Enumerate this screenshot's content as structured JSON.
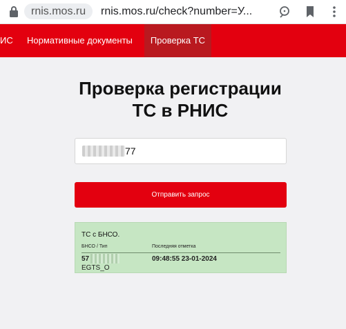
{
  "browser": {
    "domain": "rnis.mos.ru",
    "url": "rnis.mos.ru/check?number=У..."
  },
  "nav": {
    "items": [
      {
        "label": "ИС"
      },
      {
        "label": "Нормативные документы"
      },
      {
        "label": "Проверка ТС",
        "active": true
      }
    ]
  },
  "page": {
    "title_line1": "Проверка регистрации",
    "title_line2": "ТС в РНИС"
  },
  "form": {
    "number_value": "77",
    "submit_label": "Отправить запрос"
  },
  "result": {
    "title": "ТС с БНСО.",
    "columns": [
      "БНСО / Тип",
      "Последняя отметка"
    ],
    "row": {
      "id_prefix": "57",
      "type": "EGTS_O",
      "last_mark": "09:48:55 23-01-2024"
    }
  },
  "colors": {
    "brand_red": "#e3000f",
    "active_nav": "#b9191f",
    "result_bg": "#c6e6c3"
  }
}
